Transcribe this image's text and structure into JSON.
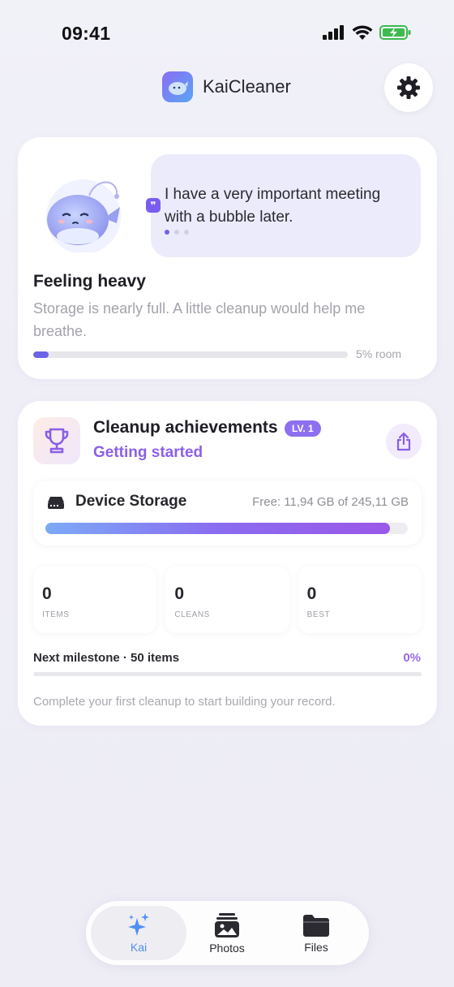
{
  "status_bar": {
    "time": "09:41"
  },
  "header": {
    "app_title": "KaiCleaner"
  },
  "mood": {
    "speech": "I have a very important meeting with a bubble later.",
    "speech_badge": "❞",
    "title": "Feeling heavy",
    "description": "Storage is nearly full. A little cleanup would help me breathe.",
    "room_label": "5% room",
    "room_fraction": 0.05
  },
  "achievements": {
    "title": "Cleanup achievements",
    "level_badge": "LV. 1",
    "subtitle": "Getting started",
    "storage": {
      "title": "Device Storage",
      "free_text": "Free: 11,94 GB of 245,11 GB",
      "used_fraction": 0.951
    },
    "stats": [
      {
        "value": "0",
        "label": "ITEMS"
      },
      {
        "value": "0",
        "label": "CLEANS"
      },
      {
        "value": "0",
        "label": "BEST"
      }
    ],
    "milestone_label": "Next milestone · 50 items",
    "milestone_pct": "0%",
    "footer": "Complete your first cleanup to start building your record."
  },
  "tabs": [
    {
      "label": "Kai",
      "icon": "sparkles-icon",
      "active": true
    },
    {
      "label": "Photos",
      "icon": "photos-icon",
      "active": false
    },
    {
      "label": "Files",
      "icon": "folder-icon",
      "active": false
    }
  ],
  "colors": {
    "accent": "#8d5fe8",
    "primary": "#6c63e6",
    "tab_active": "#4f8ff0"
  }
}
